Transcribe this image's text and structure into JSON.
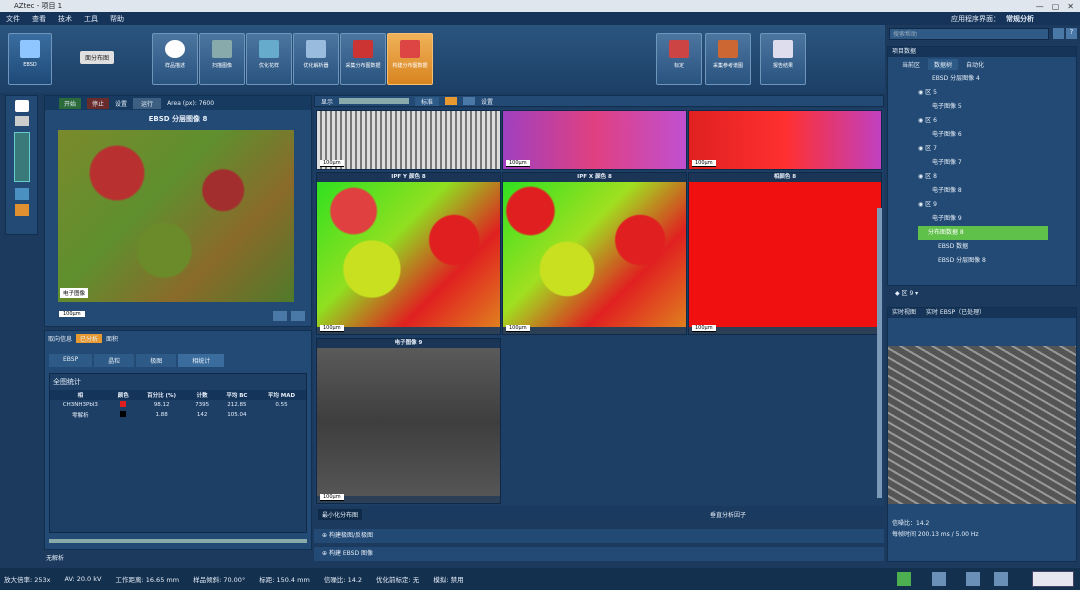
{
  "window": {
    "title": "AZtec - 项目 1",
    "controls": [
      "—",
      "▢",
      "✕"
    ]
  },
  "menu": {
    "items": [
      "文件",
      "查看",
      "技术",
      "工具",
      "帮助"
    ],
    "app_label": "应用程序界面：",
    "app_value": "常规分析"
  },
  "ribbon": {
    "ebsd": "EBSD",
    "mode": "面分布图",
    "steps": [
      "样品描述",
      "扫描图像",
      "优化花样",
      "优化解析器",
      "采集分布图数据",
      "构建分布图数据"
    ],
    "right": [
      "标定",
      "采集参考谱图",
      "报告结果"
    ]
  },
  "search": {
    "placeholder": "搜索帮助"
  },
  "left_panel": {
    "start": "开始",
    "stop": "停止",
    "settings": "设置",
    "status_btn": "运行",
    "area": "Area (px): 7600",
    "map_title": "EBSD 分层图像 8",
    "layer_label": "电子图像",
    "scale": "100μm",
    "tabs": [
      "取向信息",
      "已分析",
      "面积"
    ],
    "subtabs": [
      "EBSP",
      "晶粒",
      "极图",
      "相统计"
    ],
    "stats_title": "全图统计",
    "stats_cols": [
      "相",
      "颜色",
      "百分比 (%)",
      "计数",
      "平均 BC",
      "平均 MAD"
    ],
    "stats_rows": [
      [
        "CH3NH3PbI3",
        "",
        "98.12",
        "7395",
        "212.85",
        "0.55"
      ],
      [
        "零解析",
        "",
        "1.88",
        "142",
        "105.04",
        ""
      ]
    ],
    "footer": "无解析"
  },
  "center": {
    "show": "显示",
    "std": "标准",
    "settings": "设置",
    "tiles": [
      "IPF Y 颜色 8",
      "IPF X 颜色 8",
      "相颜色 8",
      "电子图像 9"
    ],
    "scale": "100μm",
    "bottom_tab": "最小化分布图",
    "bottom_btn": "垂直分析因子",
    "sections": [
      "构建极图/反极图",
      "构建 EBSD 图像"
    ]
  },
  "right_panel": {
    "title": "项目数据",
    "tabs": [
      "当前区",
      "数据树",
      "自动化"
    ],
    "tree": [
      "EBSD 分层图像 4",
      "区 5",
      "电子图像 5",
      "区 6",
      "电子图像 6",
      "区 7",
      "电子图像 7",
      "区 8",
      "电子图像 8",
      "区 9",
      "电子图像 9",
      "分布图数据 8",
      "EBSD 数据",
      "EBSD 分层图像 8"
    ],
    "zone": "区 9",
    "live_title": "实时视图",
    "live_mode": "实时 EBSP（已处理）",
    "snr": "信噪比：14.2",
    "time": "每帧时间 200.13 ms / 5.00 Hz"
  },
  "status": [
    "放大倍率: 253x",
    "AV: 20.0 kV",
    "工作距离: 16.65 mm",
    "样品倾斜: 70.00°",
    "标距: 150.4 mm",
    "信噪比: 14.2",
    "优化前标定: 无",
    "模拟: 禁用"
  ],
  "colors": {
    "accent": "#f0a040",
    "bg": "#1b3a5e",
    "panel": "#234a74"
  }
}
